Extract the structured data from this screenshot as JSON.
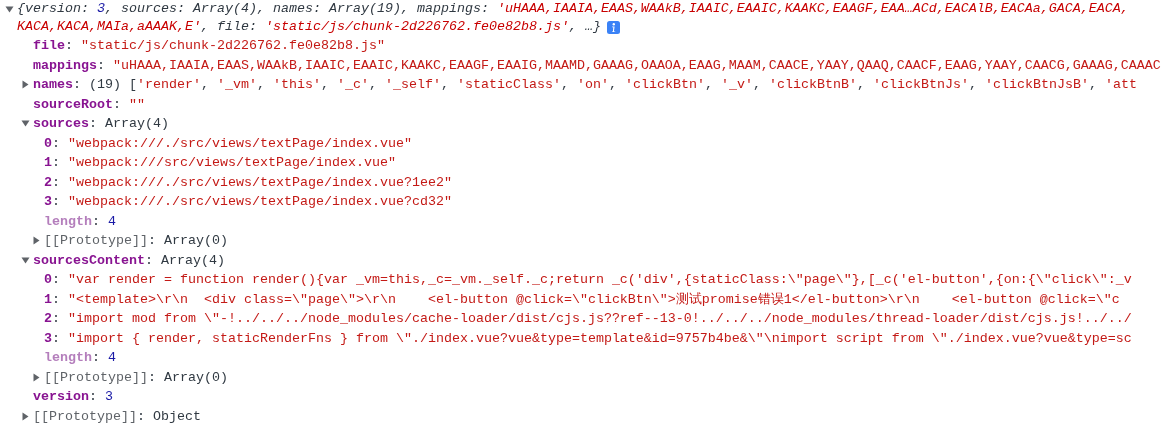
{
  "object": {
    "expanded": true,
    "summary_lines": [
      [
        {
          "text": "{version: ",
          "kind": "plain"
        },
        {
          "text": "3",
          "kind": "number"
        },
        {
          "text": ", sources: Array(4), names: Array(19), mappings: ",
          "kind": "plain"
        },
        {
          "text": "'uHAAA,IAAIA,EAAS,WAAkB,IAAIC,EAAIC,KAAKC,EAAGF,EAA…ACd,EACAlB,EACAa,GACA,EACA,",
          "kind": "string"
        }
      ],
      [
        {
          "text": "KACA,KACA,MAIa,aAAAK,E'",
          "kind": "string"
        },
        {
          "text": ", file: ",
          "kind": "plain"
        },
        {
          "text": "'static/js/chunk-2d226762.fe0e82b8.js'",
          "kind": "string"
        },
        {
          "text": ", …}",
          "kind": "plain"
        }
      ]
    ],
    "children": [
      {
        "key": "file",
        "kind": "property",
        "parts": [
          {
            "text": ": ",
            "kind": "plain"
          },
          {
            "text": "\"static/js/chunk-2d226762.fe0e82b8.js\"",
            "kind": "string"
          }
        ]
      },
      {
        "key": "mappings",
        "kind": "property",
        "parts": [
          {
            "text": ": ",
            "kind": "plain"
          },
          {
            "text": "\"uHAAA,IAAIA,EAAS,WAAkB,IAAIC,EAAIC,KAAKC,EAAGF,EAAIG,MAAMD,GAAAG,OAAOA,EAAG,MAAM,CAACE,YAAY,QAAQ,CAACF,EAAG,YAAY,CAACG,GAAAG,CAAAC",
            "kind": "string"
          }
        ]
      },
      {
        "key": "names",
        "kind": "property",
        "expanded": false,
        "parts": [
          {
            "text": ": (19) [",
            "kind": "plain"
          },
          {
            "text": "'render'",
            "kind": "string"
          },
          {
            "text": ", ",
            "kind": "plain"
          },
          {
            "text": "'_vm'",
            "kind": "string"
          },
          {
            "text": ", ",
            "kind": "plain"
          },
          {
            "text": "'this'",
            "kind": "string"
          },
          {
            "text": ", ",
            "kind": "plain"
          },
          {
            "text": "'_c'",
            "kind": "string"
          },
          {
            "text": ", ",
            "kind": "plain"
          },
          {
            "text": "'_self'",
            "kind": "string"
          },
          {
            "text": ", ",
            "kind": "plain"
          },
          {
            "text": "'staticClass'",
            "kind": "string"
          },
          {
            "text": ", ",
            "kind": "plain"
          },
          {
            "text": "'on'",
            "kind": "string"
          },
          {
            "text": ", ",
            "kind": "plain"
          },
          {
            "text": "'clickBtn'",
            "kind": "string"
          },
          {
            "text": ", ",
            "kind": "plain"
          },
          {
            "text": "'_v'",
            "kind": "string"
          },
          {
            "text": ", ",
            "kind": "plain"
          },
          {
            "text": "'clickBtnB'",
            "kind": "string"
          },
          {
            "text": ", ",
            "kind": "plain"
          },
          {
            "text": "'clickBtnJs'",
            "kind": "string"
          },
          {
            "text": ", ",
            "kind": "plain"
          },
          {
            "text": "'clickBtnJsB'",
            "kind": "string"
          },
          {
            "text": ", ",
            "kind": "plain"
          },
          {
            "text": "'att",
            "kind": "string"
          }
        ]
      },
      {
        "key": "sourceRoot",
        "kind": "property",
        "parts": [
          {
            "text": ": ",
            "kind": "plain"
          },
          {
            "text": "\"\"",
            "kind": "string"
          }
        ]
      },
      {
        "key": "sources",
        "kind": "property",
        "expanded": true,
        "parts": [
          {
            "text": ": Array(4)",
            "kind": "plain"
          }
        ],
        "children": [
          {
            "key": "0",
            "kind": "property",
            "parts": [
              {
                "text": ": ",
                "kind": "plain"
              },
              {
                "text": "\"webpack:///./src/views/textPage/index.vue\"",
                "kind": "string"
              }
            ]
          },
          {
            "key": "1",
            "kind": "property",
            "parts": [
              {
                "text": ": ",
                "kind": "plain"
              },
              {
                "text": "\"webpack:///src/views/textPage/index.vue\"",
                "kind": "string"
              }
            ]
          },
          {
            "key": "2",
            "kind": "property",
            "parts": [
              {
                "text": ": ",
                "kind": "plain"
              },
              {
                "text": "\"webpack:///./src/views/textPage/index.vue?1ee2\"",
                "kind": "string"
              }
            ]
          },
          {
            "key": "3",
            "kind": "property",
            "parts": [
              {
                "text": ": ",
                "kind": "plain"
              },
              {
                "text": "\"webpack:///./src/views/textPage/index.vue?cd32\"",
                "kind": "string"
              }
            ]
          },
          {
            "key": "length",
            "kind": "meta",
            "parts": [
              {
                "text": ": ",
                "kind": "plain"
              },
              {
                "text": "4",
                "kind": "number"
              }
            ]
          },
          {
            "key": "[[Prototype]]",
            "kind": "internal",
            "expanded": false,
            "parts": [
              {
                "text": ": Array(0)",
                "kind": "plain"
              }
            ]
          }
        ]
      },
      {
        "key": "sourcesContent",
        "kind": "property",
        "expanded": true,
        "parts": [
          {
            "text": ": Array(4)",
            "kind": "plain"
          }
        ],
        "children": [
          {
            "key": "0",
            "kind": "property",
            "parts": [
              {
                "text": ": ",
                "kind": "plain"
              },
              {
                "text": "\"var render = function render(){var _vm=this,_c=_vm._self._c;return _c('div',{staticClass:\\\"page\\\"},[_c('el-button',{on:{\\\"click\\\":_v",
                "kind": "string"
              }
            ]
          },
          {
            "key": "1",
            "kind": "property",
            "parts": [
              {
                "text": ": ",
                "kind": "plain"
              },
              {
                "text": "\"<template>\\r\\n  <div class=\\\"page\\\">\\r\\n    <el-button @click=\\\"clickBtn\\\">测试promise错误1</el-button>\\r\\n    <el-button @click=\\\"c",
                "kind": "string"
              }
            ]
          },
          {
            "key": "2",
            "kind": "property",
            "parts": [
              {
                "text": ": ",
                "kind": "plain"
              },
              {
                "text": "\"import mod from \\\"-!../../../node_modules/cache-loader/dist/cjs.js??ref--13-0!../../../node_modules/thread-loader/dist/cjs.js!../../",
                "kind": "string"
              }
            ]
          },
          {
            "key": "3",
            "kind": "property",
            "parts": [
              {
                "text": ": ",
                "kind": "plain"
              },
              {
                "text": "\"import { render, staticRenderFns } from \\\"./index.vue?vue&type=template&id=9757b4be&\\\"\\nimport script from \\\"./index.vue?vue&type=sc",
                "kind": "string"
              }
            ]
          },
          {
            "key": "length",
            "kind": "meta",
            "parts": [
              {
                "text": ": ",
                "kind": "plain"
              },
              {
                "text": "4",
                "kind": "number"
              }
            ]
          },
          {
            "key": "[[Prototype]]",
            "kind": "internal",
            "expanded": false,
            "parts": [
              {
                "text": ": Array(0)",
                "kind": "plain"
              }
            ]
          }
        ]
      },
      {
        "key": "version",
        "kind": "property",
        "parts": [
          {
            "text": ": ",
            "kind": "plain"
          },
          {
            "text": "3",
            "kind": "number"
          }
        ]
      },
      {
        "key": "[[Prototype]]",
        "kind": "internal",
        "expanded": false,
        "parts": [
          {
            "text": ": Object",
            "kind": "plain"
          }
        ]
      }
    ]
  }
}
